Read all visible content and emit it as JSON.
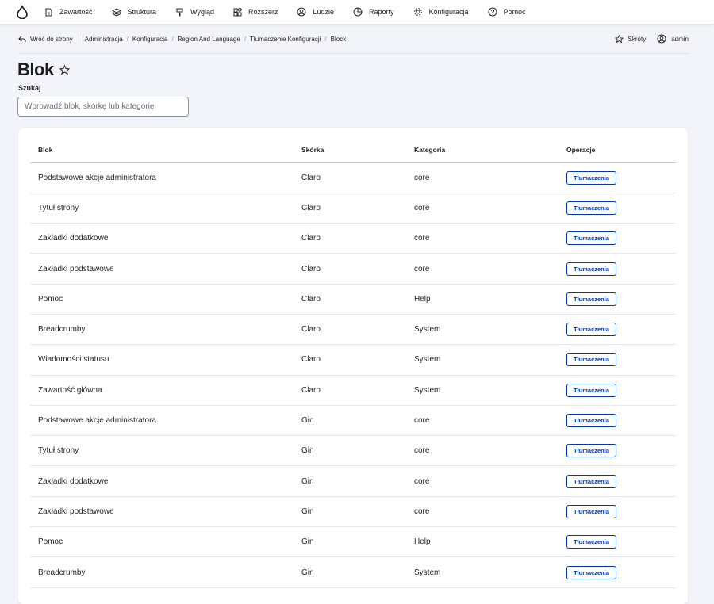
{
  "nav": {
    "items": [
      {
        "label": "Zawartość",
        "icon": "document-icon"
      },
      {
        "label": "Struktura",
        "icon": "layers-icon"
      },
      {
        "label": "Wygląd",
        "icon": "paint-icon"
      },
      {
        "label": "Rozszerz",
        "icon": "puzzle-icon"
      },
      {
        "label": "Ludzie",
        "icon": "person-icon"
      },
      {
        "label": "Raporty",
        "icon": "chart-icon"
      },
      {
        "label": "Konfiguracja",
        "icon": "gear-icon"
      },
      {
        "label": "Pomoc",
        "icon": "help-icon"
      }
    ]
  },
  "secondary": {
    "back_label": "Wróć do strony",
    "breadcrumbs": [
      "Administracja",
      "Konfiguracja",
      "Region And Language",
      "Tłumaczenie Konfiguracji",
      "Block"
    ],
    "shortcuts_label": "Skróty",
    "user_label": "admin"
  },
  "page": {
    "title": "Blok",
    "search_label": "Szukaj",
    "search_placeholder": "Wprowadź blok, skórkę lub kategorię"
  },
  "table": {
    "headers": [
      "Blok",
      "Skórka",
      "Kategoria",
      "Operacje"
    ],
    "rows": [
      {
        "block": "Podstawowe akcje administratora",
        "theme": "Claro",
        "category": "core",
        "op": "Tłumaczenia"
      },
      {
        "block": "Tytuł strony",
        "theme": "Claro",
        "category": "core",
        "op": "Tłumaczenia"
      },
      {
        "block": "Zakładki dodatkowe",
        "theme": "Claro",
        "category": "core",
        "op": "Tłumaczenia"
      },
      {
        "block": "Zakładki podstawowe",
        "theme": "Claro",
        "category": "core",
        "op": "Tłumaczenia"
      },
      {
        "block": "Pomoc",
        "theme": "Claro",
        "category": "Help",
        "op": "Tłumaczenia"
      },
      {
        "block": "Breadcrumby",
        "theme": "Claro",
        "category": "System",
        "op": "Tłumaczenia"
      },
      {
        "block": "Wiadomości statusu",
        "theme": "Claro",
        "category": "System",
        "op": "Tłumaczenia"
      },
      {
        "block": "Zawartość główna",
        "theme": "Claro",
        "category": "System",
        "op": "Tłumaczenia"
      },
      {
        "block": "Podstawowe akcje administratora",
        "theme": "Gin",
        "category": "core",
        "op": "Tłumaczenia"
      },
      {
        "block": "Tytuł strony",
        "theme": "Gin",
        "category": "core",
        "op": "Tłumaczenia"
      },
      {
        "block": "Zakładki dodatkowe",
        "theme": "Gin",
        "category": "core",
        "op": "Tłumaczenia"
      },
      {
        "block": "Zakładki podstawowe",
        "theme": "Gin",
        "category": "core",
        "op": "Tłumaczenia"
      },
      {
        "block": "Pomoc",
        "theme": "Gin",
        "category": "Help",
        "op": "Tłumaczenia"
      },
      {
        "block": "Breadcrumby",
        "theme": "Gin",
        "category": "System",
        "op": "Tłumaczenia"
      }
    ]
  },
  "colors": {
    "accent": "#0036b1",
    "background": "#f3f4f9"
  }
}
